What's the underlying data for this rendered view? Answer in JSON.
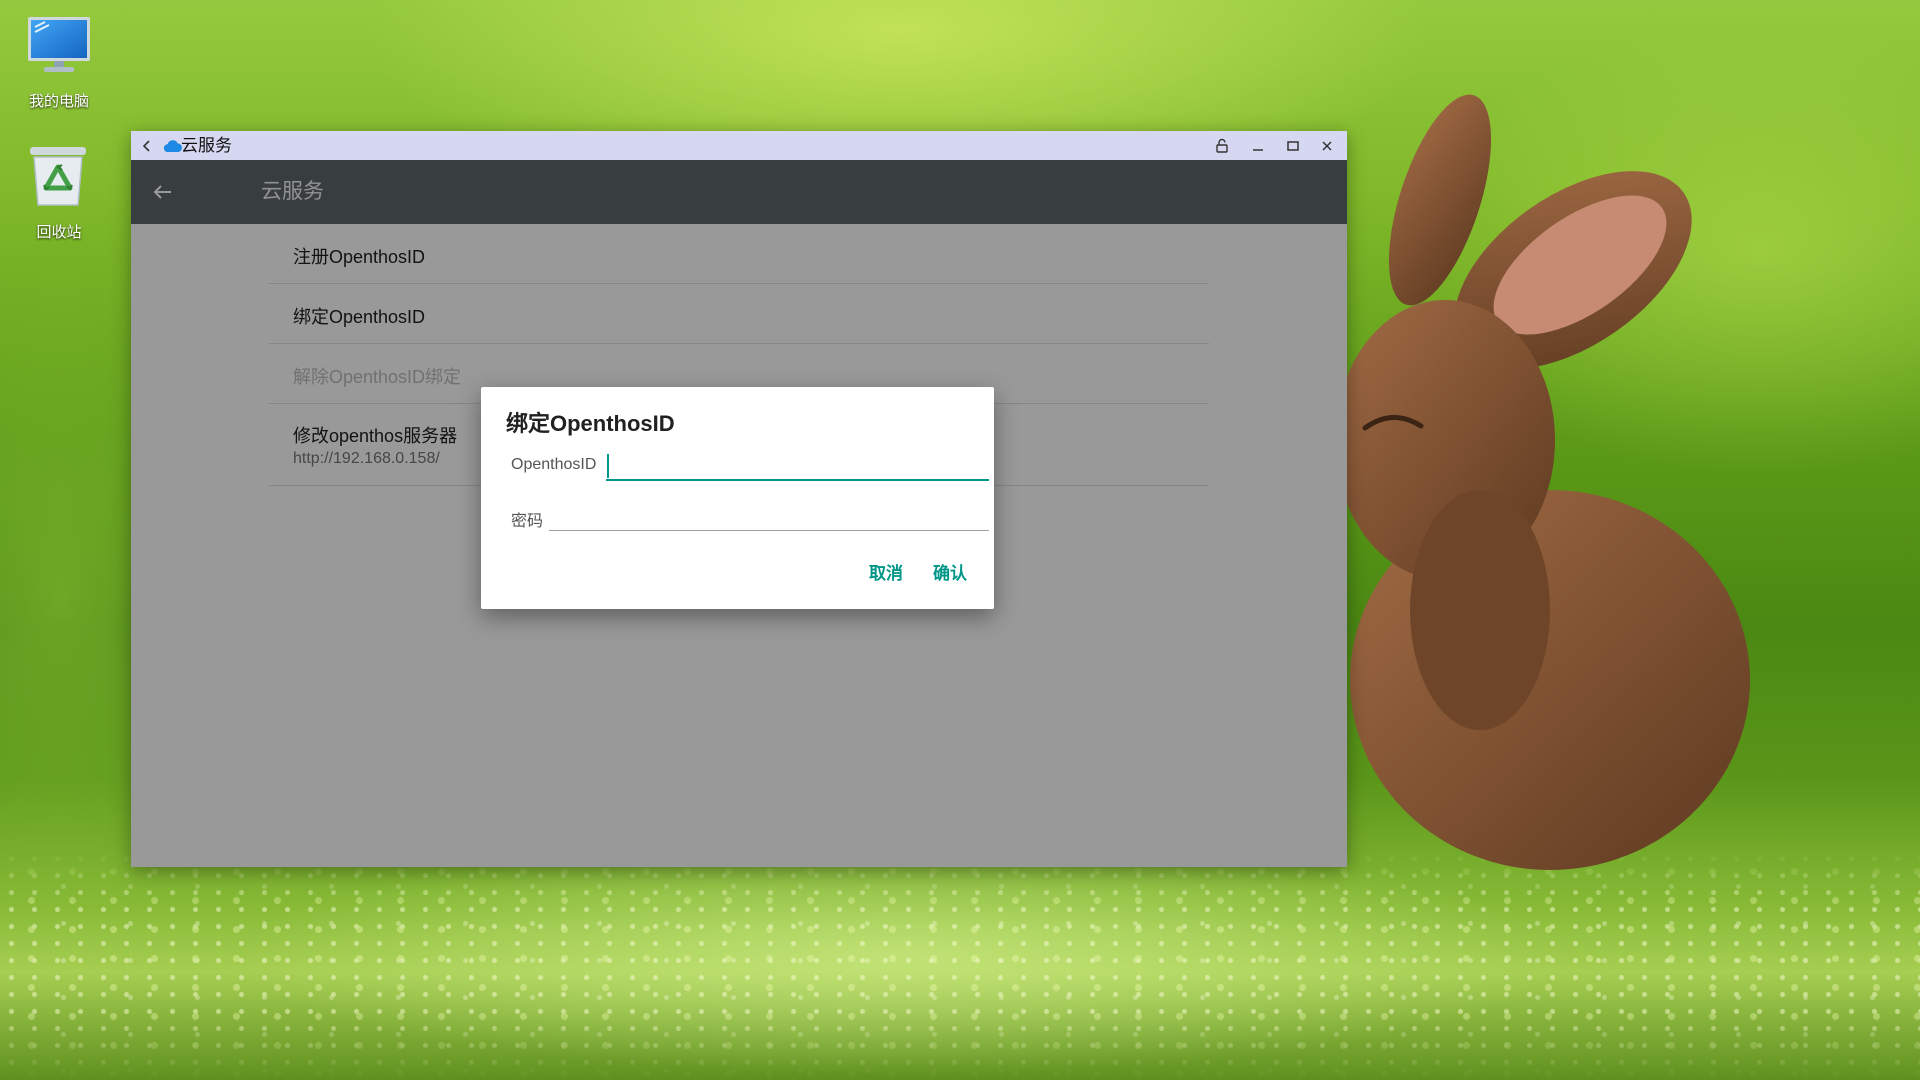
{
  "desktop": {
    "icons": [
      {
        "label": "我的电脑",
        "icon": "computer-icon"
      },
      {
        "label": "回收站",
        "icon": "recycle-bin-icon"
      }
    ]
  },
  "window": {
    "title": "云服务",
    "title_icon": "cloud-icon",
    "controls": [
      "rotate-lock-icon",
      "minimize-icon",
      "maximize-icon",
      "close-icon"
    ]
  },
  "appbar": {
    "title": "云服务",
    "back_icon": "arrow-left-icon"
  },
  "list": {
    "items": [
      {
        "title": "注册OpenthosID",
        "enabled": true
      },
      {
        "title": "绑定OpenthosID",
        "enabled": true
      },
      {
        "title": "解除OpenthosID绑定",
        "enabled": false
      },
      {
        "title": "修改openthos服务器",
        "subtitle": "http://192.168.0.158/",
        "enabled": true
      }
    ]
  },
  "dialog": {
    "title": "绑定OpenthosID",
    "fields": [
      {
        "label": "OpenthosID",
        "value": "",
        "focused": true
      },
      {
        "label": "密码",
        "value": "",
        "focused": false
      }
    ],
    "cancel_label": "取消",
    "confirm_label": "确认"
  },
  "colors": {
    "accent": "#009688",
    "titlebar": "#d6d8f1",
    "appbar": "#5e666c",
    "cloud": "#1e88e5"
  }
}
